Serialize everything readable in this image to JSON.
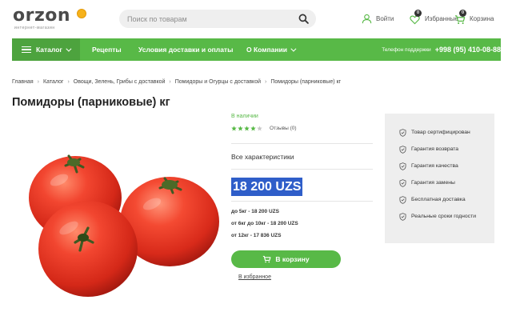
{
  "header": {
    "logo_text": "orzon",
    "logo_tagline": "интернет-магазин",
    "search_placeholder": "Поиск по товарам",
    "login_label": "Войти",
    "favorites_label": "Избранные",
    "favorites_count": "0",
    "cart_label": "Корзина",
    "cart_count": "0"
  },
  "nav": {
    "catalog_label": "Каталог",
    "items": [
      {
        "label": "Рецепты"
      },
      {
        "label": "Условия доставки и оплаты"
      },
      {
        "label": "О Компании"
      }
    ],
    "support_label": "Телефон поддержки",
    "support_phone": "+998 (95) 410-08-88"
  },
  "breadcrumb": [
    "Главная",
    "Каталог",
    "Овощи, Зелень, Грибы с доставкой",
    "Помидоры и Огурцы с доставкой",
    "Помидоры (парниковые) кг"
  ],
  "product": {
    "title": "Помидоры (парниковые) кг",
    "availability": "В наличии",
    "rating": 4,
    "rating_max": 5,
    "reviews_label": "Отзывы (0)",
    "specs_label": "Все характеристики",
    "price": "18 200 UZS",
    "price_tiers": [
      "до 5кг - 18 200 UZS",
      "от 6кг до 10кг - 18 200 UZS",
      "от 12кг - 17 836 UZS"
    ],
    "add_to_cart_label": "В корзину",
    "add_to_favorites_label": "В избранное"
  },
  "guarantees": [
    "Товар сертифицирован",
    "Гарантия возврата",
    "Гарантия качества",
    "Гарантия замены",
    "Бесплатная доставка",
    "Реальные сроки годности"
  ],
  "colors": {
    "brand_green": "#58b947",
    "price_highlight": "#2f5ec9",
    "logo_orange": "#f6b21b",
    "tomato_red": "#e83a2a"
  },
  "icons": {
    "search": "search-icon",
    "login": "user-icon",
    "favorites": "heart-icon",
    "cart": "cart-icon",
    "catalog": "menu-icon",
    "guarantee": "shield-check-icon",
    "rating": "star-icon"
  }
}
